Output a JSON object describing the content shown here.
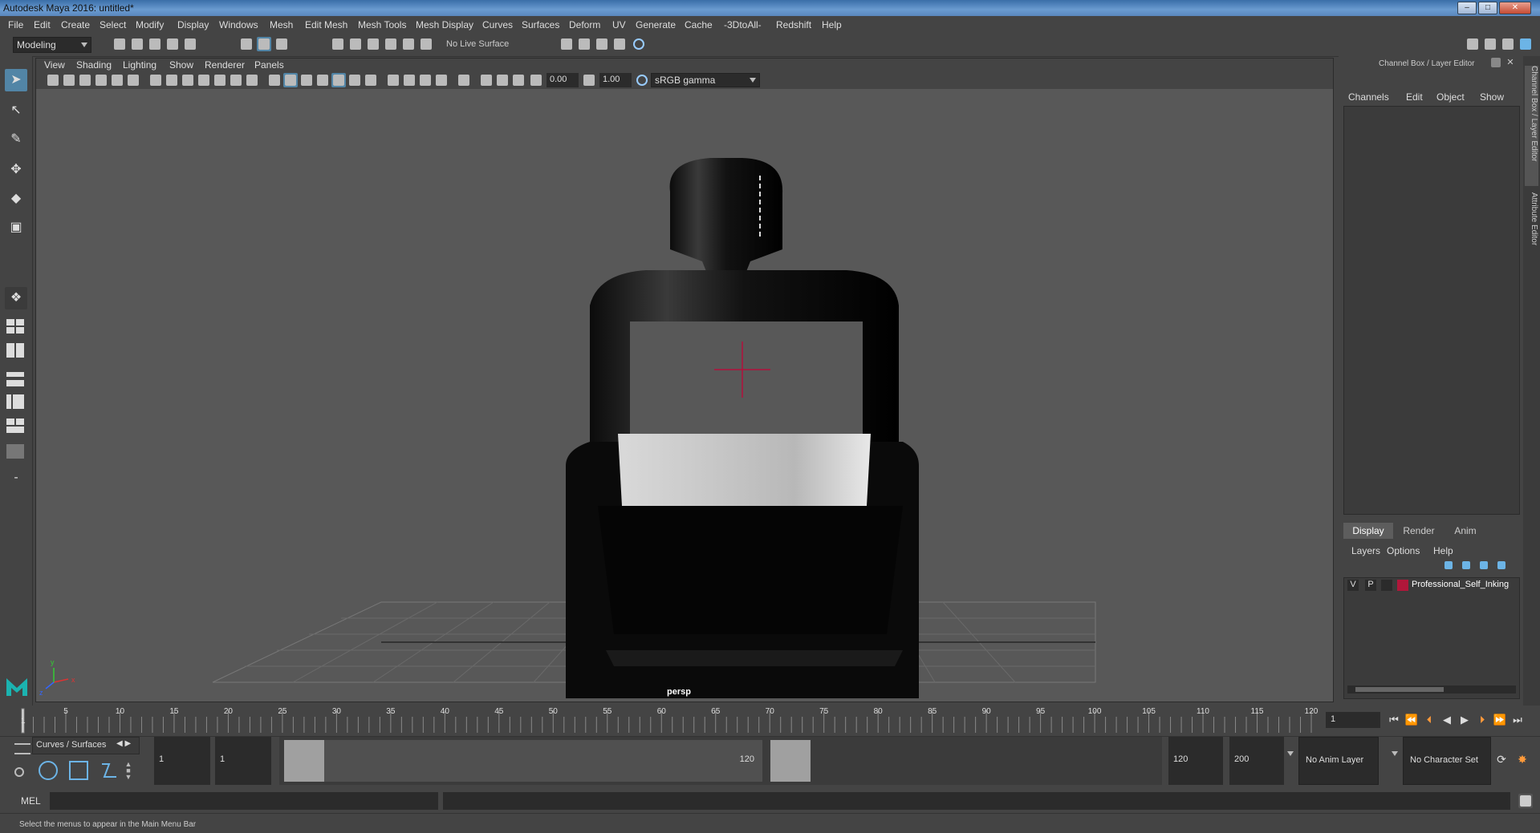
{
  "window": {
    "title": "Autodesk Maya 2016: untitled*",
    "minimize": "–",
    "maximize": "□",
    "close": "✕"
  },
  "menubar": [
    "File",
    "Edit",
    "Create",
    "Select",
    "Modify",
    "Display",
    "Windows",
    "Mesh",
    "Edit Mesh",
    "Mesh Tools",
    "Mesh Display",
    "Curves",
    "Surfaces",
    "Deform",
    "UV",
    "Generate",
    "Cache",
    "-3DtoAll-",
    "Redshift",
    "Help"
  ],
  "shelf": {
    "mode": "Modeling",
    "live_surface": "No Live Surface"
  },
  "panel": {
    "menus": [
      "View",
      "Shading",
      "Lighting",
      "Show",
      "Renderer",
      "Panels"
    ],
    "exposure": "0.00",
    "gamma": "1.00",
    "color_space": "sRGB gamma",
    "camera": "persp"
  },
  "axis": {
    "x": "x",
    "y": "y",
    "z": "z"
  },
  "channel_box": {
    "header": "Channel Box / Layer Editor",
    "menus": [
      "Channels",
      "Edit",
      "Object",
      "Show"
    ]
  },
  "layer_editor": {
    "tabs": [
      "Display",
      "Render",
      "Anim"
    ],
    "active_tab": "Display",
    "menus": [
      "Layers",
      "Options",
      "Help"
    ],
    "layers": [
      {
        "visible": "V",
        "playback": "P",
        "color": "#b0173a",
        "name": "Professional_Self_Inking"
      }
    ]
  },
  "side_tabs": [
    "Channel Box / Layer Editor",
    "Attribute Editor"
  ],
  "timeline": {
    "ticks": [
      "5",
      "10",
      "15",
      "20",
      "25",
      "30",
      "35",
      "40",
      "45",
      "50",
      "55",
      "60",
      "65",
      "70",
      "75",
      "80",
      "85",
      "90",
      "95",
      "100",
      "105",
      "110",
      "115",
      "120"
    ],
    "first_tick": "1",
    "current_frame": "1"
  },
  "range": {
    "shelf_tab": "Curves / Surfaces",
    "start_field": "1",
    "playback_start": "1",
    "slider_start": "1",
    "slider_end": "120",
    "playback_end": "120",
    "end_field": "200",
    "anim_layer": "No Anim Layer",
    "character_set": "No Character Set"
  },
  "command": {
    "label": "MEL"
  },
  "help": {
    "text": "Select the menus to appear in the Main Menu Bar"
  },
  "colors": {
    "accent": "#5285a6",
    "layer_color": "#b0173a",
    "viewport_bg": "#585858"
  }
}
